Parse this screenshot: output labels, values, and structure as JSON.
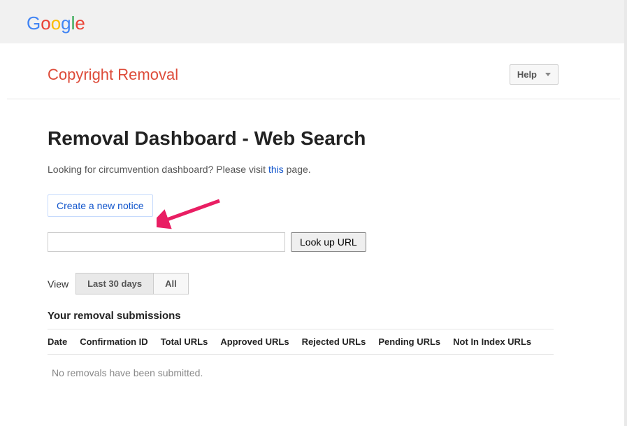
{
  "logo": {
    "g1": "G",
    "o1": "o",
    "o2": "o",
    "g2": "g",
    "l1": "l",
    "e1": "e"
  },
  "header": {
    "title": "Copyright Removal",
    "help": "Help"
  },
  "page": {
    "title": "Removal Dashboard - Web Search",
    "desc_before": "Looking for circumvention dashboard? Please visit ",
    "desc_link": "this",
    "desc_after": " page.",
    "create_notice": "Create a new notice",
    "lookup_btn": "Look up URL",
    "view_label": "View",
    "tabs": {
      "last30": "Last 30 days",
      "all": "All"
    }
  },
  "table": {
    "title": "Your removal submissions",
    "headers": {
      "date": "Date",
      "confirmation": "Confirmation ID",
      "total": "Total URLs",
      "approved": "Approved URLs",
      "rejected": "Rejected URLs",
      "pending": "Pending URLs",
      "not_in_index": "Not In Index URLs"
    },
    "empty": "No removals have been submitted."
  }
}
